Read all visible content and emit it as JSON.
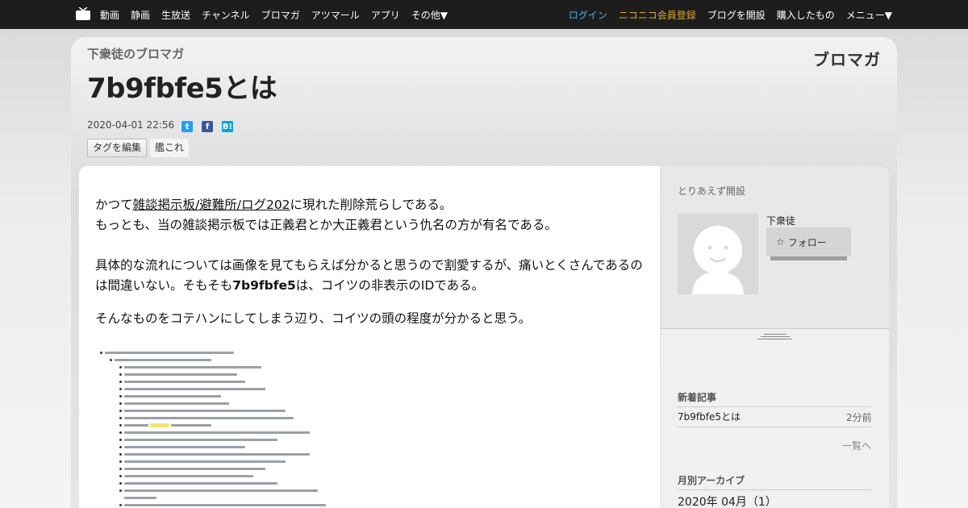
{
  "nav": {
    "left": [
      "動画",
      "静画",
      "生放送",
      "チャンネル",
      "ブロマガ",
      "アツマール",
      "アプリ",
      "その他▼"
    ],
    "login": "ログイン",
    "premium": "ニコニコ会員登録",
    "open_blog": "ブログを開設",
    "purchased": "購入したもの",
    "menu": "メニュー▼"
  },
  "header": {
    "blog_name": "下衆徒のブロマガ",
    "title": "7b9fbfe5とは",
    "brand": "ブロマガ",
    "date": "2020-04-01 22:56",
    "tag_edit": "タグを編集",
    "tag": "艦これ"
  },
  "article": {
    "p1_pre": "かつて",
    "p1_link": "雑談掲示板/避難所/ログ202",
    "p1_post": "に現れた削除荒らしである。",
    "p1_line2": "もっとも、当の雑談掲示板では正義君とか大正義君という仇名の方が有名である。",
    "p2_pre": "具体的な流れについては画像を見てもらえば分かると思うので割愛するが、痛いとくさんであるのは間違いない。そもそも",
    "p2_bold": "7b9fbfe5",
    "p2_post": "は、コイツの非表示のIDである。",
    "p3": "そんなものをコテハンにしてしまう辺り、コイツの頭の程度が分かると思う。"
  },
  "sidebar": {
    "description": "とりあえず開設",
    "user": "下衆徒",
    "follow": "フォロー",
    "new_title": "新着記事",
    "new_item": "7b9fbfe5とは",
    "new_item_time": "2分前",
    "more": "一覧へ",
    "archive_title": "月別アーカイブ",
    "archive_item": "2020年 04月（1）"
  }
}
